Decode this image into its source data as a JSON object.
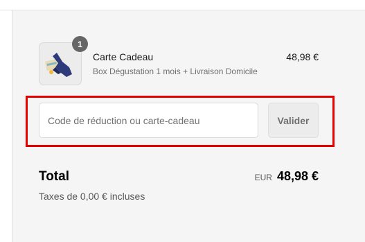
{
  "product": {
    "name": "Carte Cadeau",
    "variant": "Box Dégustation 1 mois + Livraison Domicile",
    "price": "48,98 €",
    "quantity": "1",
    "image_icon": "gift-card-hand-icon"
  },
  "discount": {
    "placeholder": "Code de réduction ou carte-cadeau",
    "value": "",
    "apply_label": "Valider"
  },
  "total": {
    "label": "Total",
    "currency": "EUR",
    "amount": "48,98 €",
    "taxes": "Taxes de 0,00 € incluses"
  },
  "colors": {
    "highlight": "#e60000",
    "summary_background": "#f5f5f5",
    "badge": "#666666"
  }
}
